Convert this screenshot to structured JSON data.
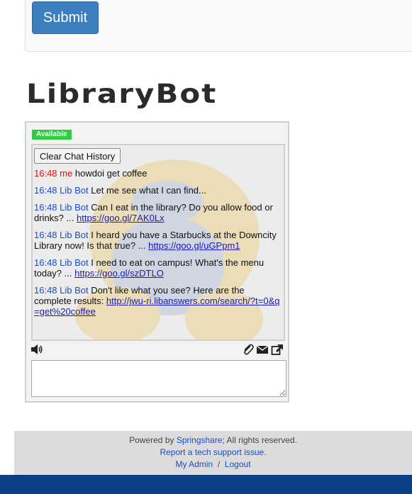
{
  "form": {
    "submit_label": "Submit"
  },
  "bot": {
    "title": "LibraryBot",
    "status": "Available",
    "clear_label": "Clear Chat History",
    "messages": [
      {
        "time": "16:48",
        "sender": "me",
        "text": "howdoi get coffee",
        "link": ""
      },
      {
        "time": "16:48",
        "sender": "Lib Bot",
        "text": "Let me see what I can find...",
        "link": ""
      },
      {
        "time": "16:48",
        "sender": "Lib Bot",
        "text": "Can I eat in the library? Do you allow food or drinks? ...",
        "link": "https://goo.gl/7AK0Lx"
      },
      {
        "time": "16:48",
        "sender": "Lib Bot",
        "text": "I heard you have a Starbucks at the Downcity Library now! Is that true? ...",
        "link": "https://goo.gl/uGPpm1"
      },
      {
        "time": "16:48",
        "sender": "Lib Bot",
        "text": "I need to eat on campus! What's the menu today? ...",
        "link": "https://goo.gl/szDTLO"
      },
      {
        "time": "16:48",
        "sender": "Lib Bot",
        "text": "Don't like what you see? Here are the complete results:",
        "link": "http://jwu-ri.libanswers.com/search/?t=0&q=get%20coffee"
      }
    ],
    "toolbar_icons": [
      "speaker-icon",
      "paperclip-icon",
      "envelope-icon",
      "external-link-icon"
    ],
    "input_value": ""
  },
  "footer": {
    "powered_prefix": "Powered by",
    "powered_link": "Springshare",
    "powered_suffix": "; All rights reserved.",
    "report_link": "Report a tech support issue.",
    "admin_link": "My Admin",
    "separator": "/",
    "logout_link": "Logout"
  },
  "colors": {
    "accent": "#3c7fbf",
    "status": "#2ecc40",
    "bot_timestamp": "#1a4dc2",
    "me_timestamp": "#dd1111",
    "bottom_bar": "#0d3f86"
  }
}
